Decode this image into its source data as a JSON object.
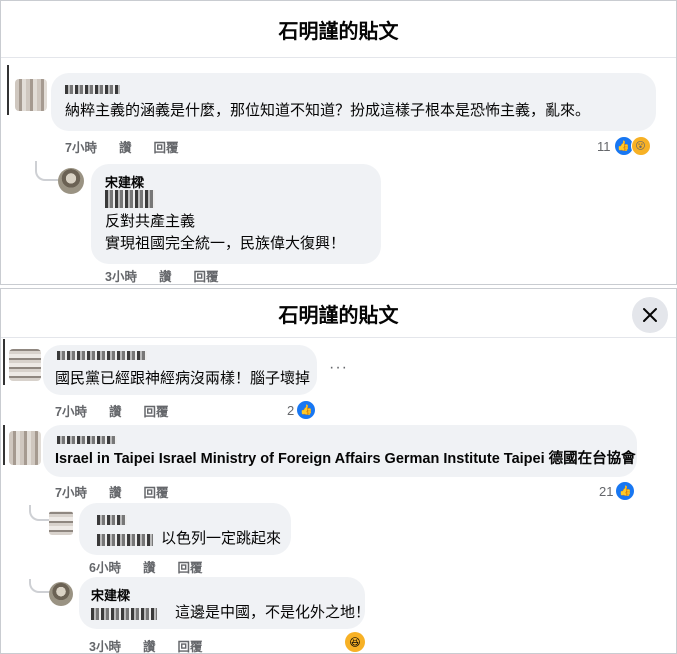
{
  "panel1": {
    "title": "石明謹的貼文",
    "comment": {
      "text": "納粹主義的涵義是什麼，那位知道不知道？扮成這樣子根本是恐怖主義，亂來。",
      "time": "7小時",
      "like": "讚",
      "reply": "回覆",
      "reaction_count": "11",
      "icons": [
        "like-icon",
        "wow-icon"
      ]
    },
    "reply": {
      "name": "宋建樑",
      "line1": "反對共產主義",
      "line2": "實現祖國完全統一，民族偉大復興！",
      "time": "3小時",
      "like": "讚",
      "reply": "回覆"
    }
  },
  "panel2": {
    "title": "石明謹的貼文",
    "close_icon": "close-icon",
    "comment1": {
      "text": "國民黨已經跟神經病沒兩樣！腦子壞掉",
      "time": "7小時",
      "like": "讚",
      "reply": "回覆",
      "reaction_count": "2",
      "more": "···"
    },
    "comment2": {
      "text": "Israel in Taipei Israel Ministry of Foreign Affairs German Institute Taipei 德國在台協會",
      "time": "7小時",
      "like": "讚",
      "reply": "回覆",
      "reaction_count": "21"
    },
    "reply1": {
      "text": "以色列一定跳起來",
      "time": "6小時",
      "like": "讚",
      "reply": "回覆"
    },
    "reply2": {
      "name": "宋建樑",
      "text": "這邊是中國，不是化外之地！",
      "time": "3小時",
      "like": "讚",
      "reply": "回覆"
    }
  }
}
